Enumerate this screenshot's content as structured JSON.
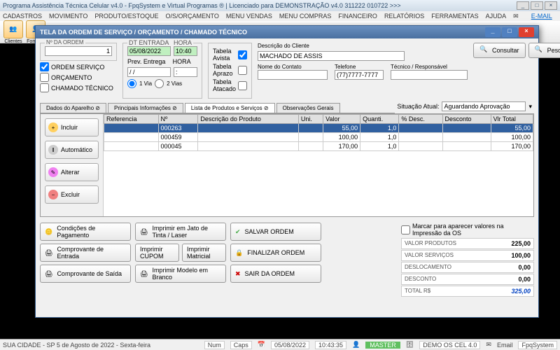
{
  "app": {
    "title": "Programa Assistência Técnica Celular v4.0 - FpqSystem e Virtual Programas ® | Licenciado para DEMONSTRAÇÃO v4.0 311222 010722 >>>"
  },
  "menu": {
    "items": [
      "CADASTROS",
      "MOVIMENTO",
      "PRODUTO/ESTOQUE",
      "O/S/ORÇAMENTO",
      "MENU VENDAS",
      "MENU COMPRAS",
      "FINANCEIRO",
      "RELATÓRIOS",
      "FERRAMENTAS",
      "AJUDA"
    ],
    "email": "E-MAIL"
  },
  "toolbar": {
    "items": [
      {
        "label": "Clientes",
        "glyph": "👥"
      },
      {
        "label": "Fornece",
        "glyph": "👤"
      }
    ]
  },
  "modal": {
    "title": "TELA DA ORDEM DE SERVIÇO / ORÇAMENTO / CHAMADO TÉCNICO",
    "ordem": {
      "legend": "Nº DA ORDEM",
      "value": "1"
    },
    "tipo": {
      "ordem_servico": "ORDEM SERVIÇO",
      "orcamento": "ORÇAMENTO",
      "chamado": "CHAMADO TÉCNICO"
    },
    "entrada": {
      "legend": "DT ENTRADA",
      "hora": "HORA",
      "date": "05/08/2022",
      "time": "10:40",
      "prev": "Prev. Entrega",
      "prev_date": "/ /",
      "prev_time": ":",
      "via1": "1 Via",
      "via2": "2 Vias"
    },
    "tabela": {
      "avista": "Tabela Avista",
      "aprazo": "Tabela Aprazo",
      "atacado": "Tabela Atacado"
    },
    "cliente": {
      "desc_legend": "Descrição do Cliente",
      "desc": "MACHADO DE ASSIS",
      "contato_legend": "Nome do Contato",
      "contato": "",
      "tel_legend": "Telefone",
      "tel": "(77)7777-7777",
      "resp_legend": "Técnico / Responsável",
      "resp": ""
    },
    "btns": {
      "consultar": "Consultar",
      "pesquisar": "Pesquisar"
    },
    "tabs": [
      "Dados do Aparelho ⊘",
      "Principais Informações ⊘",
      "Lista de Produtos e Serviços ⊘",
      "Observações Gerais"
    ],
    "status": {
      "label": "Situação Atual:",
      "value": "Aguardando Aprovação"
    },
    "side": {
      "incluir": "Incluir",
      "automatico": "Automático",
      "alterar": "Alterar",
      "excluir": "Excluir"
    },
    "grid": {
      "headers": [
        "Referencia",
        "Nº",
        "Descrição do Produto",
        "Uni.",
        "Valor",
        "Quanti.",
        "% Desc.",
        "Desconto",
        "Vlr Total"
      ],
      "rows": [
        {
          "ref": "",
          "no": "000263",
          "desc": "",
          "uni": "",
          "valor": "55,00",
          "qt": "1,0",
          "pdesc": "",
          "tot": "55,00",
          "sel": true
        },
        {
          "ref": "",
          "no": "000459",
          "desc": "",
          "uni": "",
          "valor": "100,00",
          "qt": "1,0",
          "pdesc": "",
          "tot": "100,00"
        },
        {
          "ref": "",
          "no": "000045",
          "desc": "",
          "uni": "",
          "valor": "170,00",
          "qt": "1,0",
          "pdesc": "",
          "tot": "170,00"
        }
      ]
    },
    "foot": {
      "cond": "Condições de Pagamento",
      "jato": "Imprimir em Jato de Tinta / Laser",
      "salvar": "SALVAR ORDEM",
      "entrada": "Comprovante de Entrada",
      "cupom": "Imprimir CUPOM",
      "matricial": "Imprimir Matricial",
      "finalizar": "FINALIZAR ORDEM",
      "saida": "Comprovante de Saída",
      "branco": "Imprimir Modelo em Branco",
      "sair": "SAIR DA ORDEM"
    },
    "totals": {
      "print_check": "Marcar para aparecer valores na Impressão da OS",
      "prod_lbl": "VALOR PRODUTOS",
      "prod": "225,00",
      "serv_lbl": "VALOR SERVIÇOS",
      "serv": "100,00",
      "desl_lbl": "DESLOCAMENTO",
      "desl": "0,00",
      "desc_lbl": "DESCONTO",
      "desc": "0,00",
      "tot_lbl": "TOTAL R$",
      "tot": "325,00"
    }
  },
  "status": {
    "left": "SUA CIDADE - SP  5 de Agosto de 2022 - Sexta-feira",
    "num": "Num",
    "caps": "Caps",
    "date": "05/08/2022",
    "time": "10:43:35",
    "master": "MASTER",
    "demo": "DEMO OS CEL 4.0",
    "email": "Email",
    "brand": "FpqSystem"
  }
}
